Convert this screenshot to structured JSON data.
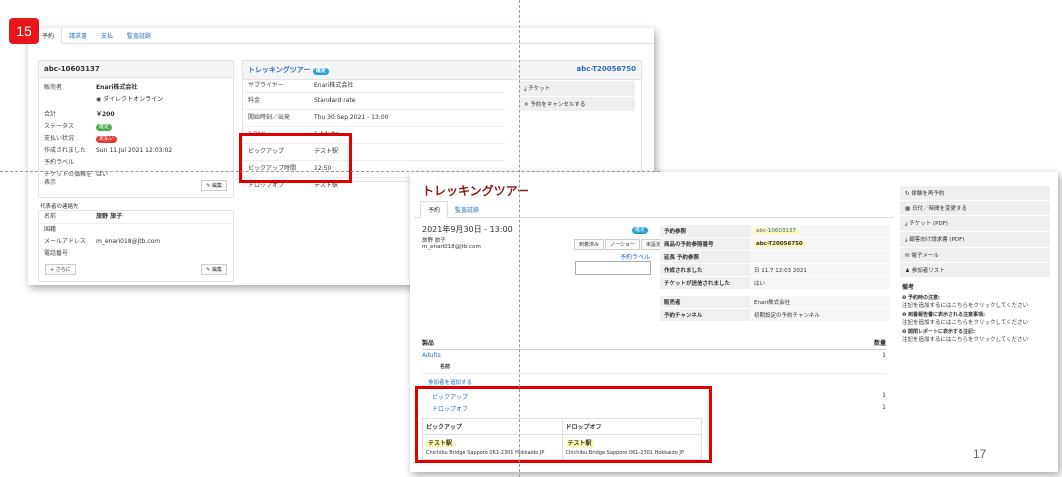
{
  "slide_number": "15",
  "page_number": "17",
  "shot1": {
    "tabs": [
      "予約",
      "請求書",
      "支払",
      "監査証跡"
    ],
    "booking": {
      "id": "abc-10603137",
      "rows": [
        {
          "k": "販売者",
          "v": "Enari株式会社"
        },
        {
          "k": "",
          "v": "ダイレクトオンライン"
        },
        {
          "k": "合計",
          "v": "￥200"
        },
        {
          "k": "ステータス",
          "v": "確定"
        },
        {
          "k": "支払い状況",
          "v": "未払い"
        },
        {
          "k": "作成されました",
          "v": "Sun 11.Jul 2021 12:03:02"
        },
        {
          "k": "予約ラベル",
          "v": ""
        },
        {
          "k": "チケットの価格を表示",
          "v": "はい"
        }
      ],
      "edit_label": "編集"
    },
    "contact": {
      "title": "代表者の連絡先",
      "rows": [
        {
          "k": "名前",
          "v": "旅野 旅子"
        },
        {
          "k": "国籍",
          "v": ""
        },
        {
          "k": "メールアドレス",
          "v": "m_enari018@jtb.com"
        },
        {
          "k": "電話番号",
          "v": ""
        }
      ],
      "more_label": "+ さらに",
      "edit_label": "編集"
    },
    "product": {
      "title": "トレッキングツアー",
      "badge": "確定",
      "ref": "abc-T20056750",
      "rows": [
        {
          "k": "サプライヤー",
          "v": "Enari株式会社"
        },
        {
          "k": "料金",
          "v": "Standard rate"
        },
        {
          "k": "開始時刻／出発",
          "v": "Thu 30.Sep 2021 - 13:00"
        },
        {
          "k": "1 PAX",
          "v": "1 Adults"
        },
        {
          "k": "ピックアップ",
          "v": "テスト駅"
        },
        {
          "k": "ピックアップ時間",
          "v": "12:50"
        },
        {
          "k": "ドロップオフ",
          "v": "テスト駅"
        }
      ],
      "actions": [
        "チケット",
        "予約をキャンセルする"
      ]
    }
  },
  "shot2": {
    "title": "トレッキングツアー",
    "tabs": [
      "予約",
      "監査証跡"
    ],
    "datetime": "2021年9月30日 - 13:00",
    "customer_name": "旅野 旅子",
    "customer_email": "m_enari018@jtb.com",
    "badge": "確定",
    "buttons": [
      "到着済み",
      "ノーショー",
      "未設定"
    ],
    "label_link": "予約ラベル",
    "details": [
      {
        "k": "予約参照",
        "v": "abc-10603137",
        "hl": true
      },
      {
        "k": "商品の予約参照番号",
        "v": "abc-T20056750",
        "hl": true
      },
      {
        "k": "延長 予約参照",
        "v": ""
      },
      {
        "k": "作成されました",
        "v": "日 11.7 12:03 2021"
      },
      {
        "k": "チケットが送信されました",
        "v": "はい"
      }
    ],
    "seller": [
      {
        "k": "販売者",
        "v": "Enari株式会社"
      },
      {
        "k": "予約チャンネル",
        "v": "初期設定の予約チャンネル"
      }
    ],
    "actions": [
      "体験を再予約",
      "日付／時間を変更する",
      "チケット (PDF)",
      "顧客向け請求書 (PDF)",
      "電子メール",
      "参加者リスト"
    ],
    "notes_title": "備考",
    "notes": [
      {
        "t": "予約時の注意:",
        "d": "注記を追加するにはこちらをクリックしてください"
      },
      {
        "t": "到着報告書に表示される注意事項:",
        "d": "注記を追加するにはこちらをクリックしてください"
      },
      {
        "t": "開閉レポートに表示する注記:",
        "d": "注記を追加するにはこちらをクリックしてください"
      }
    ],
    "products_header": "製品",
    "qty_header": "数量",
    "product_rows": [
      {
        "name": "Adults",
        "qty": "1"
      },
      {
        "name": "名前",
        "qty": ""
      }
    ],
    "add_participant": "参加者を追加する",
    "extras": [
      {
        "name": "ピックアップ",
        "qty": "1"
      },
      {
        "name": "ドロップオフ",
        "qty": "1"
      }
    ],
    "pickup": {
      "header": "ピックアップ",
      "station": "テスト駅",
      "address": "Chichibu Bridge Sapporo 061-2301 Hokkaido JP"
    },
    "dropoff": {
      "header": "ドロップオフ",
      "station": "テスト駅",
      "address": "Chichibu Bridge Sapporo 061-2301 Hokkaido JP"
    }
  }
}
